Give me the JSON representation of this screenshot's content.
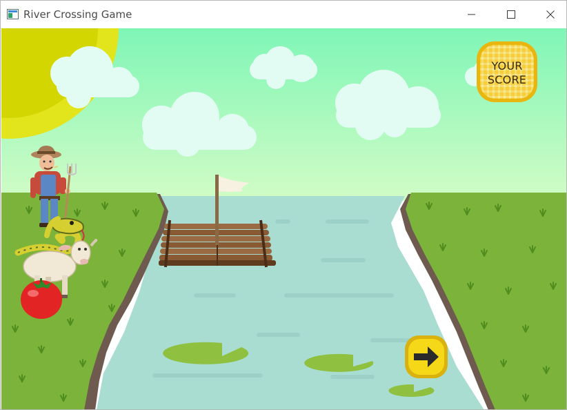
{
  "window": {
    "title": "River Crossing Game"
  },
  "score": {
    "line1": "YOUR",
    "line2": "SCORE"
  },
  "characters": [
    "farmer",
    "snake",
    "goat",
    "tomato"
  ],
  "colors": {
    "sky": "#86f7b9",
    "sun": "#e3e71a",
    "grass": "#7cb33b",
    "river": "#a9ddd2",
    "raft": "#8a5a35",
    "badge": "#f2c51b",
    "arrow_button": "#f5d817"
  }
}
